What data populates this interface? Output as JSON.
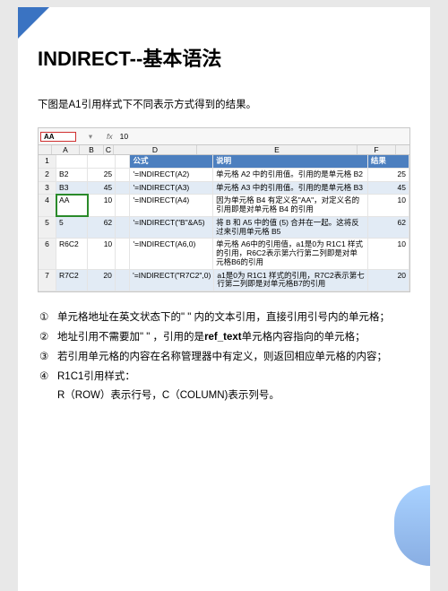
{
  "title": "INDIRECT--基本语法",
  "subtitle": "下图是A1引用样式下不同表示方式得到的结果。",
  "excel": {
    "namebox": "AA",
    "fxlabel": "fx",
    "fxvalue": "10",
    "cols": [
      "A",
      "B",
      "C",
      "D",
      "E",
      "F"
    ],
    "th": {
      "d": "公式",
      "e": "说明",
      "f": "结果"
    },
    "rows": [
      {
        "n": "2",
        "a": "B2",
        "b": "25",
        "d": "'=INDIRECT(A2)",
        "e": "单元格 A2 中的引用值。引用的是单元格 B2",
        "f": "25",
        "band": false
      },
      {
        "n": "3",
        "a": "B3",
        "b": "45",
        "d": "'=INDIRECT(A3)",
        "e": "单元格 A3 中的引用值。引用的是单元格 B3",
        "f": "45",
        "band": true
      },
      {
        "n": "4",
        "a": "AA",
        "b": "10",
        "d": "'=INDIRECT(A4)",
        "e": "因为单元格 B4 有定义名\"AA\"，对定义名的引用即是对单元格 B4 的引用",
        "f": "10",
        "band": false,
        "active": true
      },
      {
        "n": "5",
        "a": "5",
        "b": "62",
        "d": "'=INDIRECT(\"B\"&A5)",
        "e": "将 B 和 A5 中的值 (5) 合并在一起。这将反过来引用单元格 B5",
        "f": "62",
        "band": true
      },
      {
        "n": "6",
        "a": "R6C2",
        "b": "10",
        "d": "'=INDIRECT(A6,0)",
        "e": "单元格 A6中的引用值，a1是0为 R1C1 样式的引用，R6C2表示第六行第二列即是对单元格B6的引用",
        "f": "10",
        "band": false
      },
      {
        "n": "7",
        "a": "R7C2",
        "b": "20",
        "d": "'=INDIRECT(\"R7C2\",0)",
        "e": "a1是0为 R1C1 样式的引用，R7C2表示第七行第二列即是对单元格B7的引用",
        "f": "20",
        "band": true
      }
    ]
  },
  "notes": [
    {
      "n": "①",
      "text": "单元格地址在英文状态下的\" \" 内的文本引用，直接引用引号内的单元格；"
    },
    {
      "n": "②",
      "text": "地址引用不需要加\" \" ，引用的是",
      "bold": "ref_text",
      "tail": "单元格内容指向的单元格；"
    },
    {
      "n": "③",
      "text": "若引用单元格的内容在名称管理器中有定义，则返回相应单元格的内容；"
    },
    {
      "n": "④",
      "text": "R1C1引用样式："
    }
  ],
  "note4_line2": "R（ROW）表示行号，C（COLUMN)表示列号。"
}
